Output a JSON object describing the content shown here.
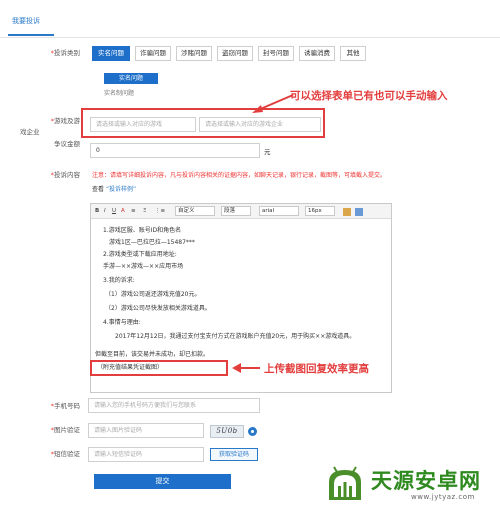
{
  "top_tab": "我要投诉",
  "labels": {
    "category": "投诉类别",
    "game_company_1": "游戏及游",
    "game_company_2": "戏企业",
    "amount": "争议金额",
    "content": "投诉内容",
    "phone": "手机号码",
    "captcha": "图片验证",
    "sms": "短信验证"
  },
  "categories": [
    "实名问题",
    "诈骗问题",
    "涉赌问题",
    "盗窃问题",
    "封号问题",
    "诱骗消费",
    "其他"
  ],
  "sub_selected": "实名问题",
  "sub_option": "实名制问题",
  "inputs": {
    "game_placeholder": "请选择或输入对应的游戏",
    "company_placeholder": "请选择或输入对应的游戏企业",
    "amount_value": "0",
    "amount_unit": "元",
    "phone_placeholder": "请输入您的手机号码方便我们与您联系",
    "captcha_placeholder": "请输入图片验证码",
    "sms_placeholder": "请输入短信验证码"
  },
  "notice": "注意：请填写详细投诉内容，凡与投诉内容相关的证据内容，如聊天记录，银行记录，截图等，可填截入提交。",
  "example": {
    "prefix": "查看",
    "link": "“投诉样例”"
  },
  "toolbar": {
    "items": [
      "B",
      "I",
      "U",
      "A",
      "≡",
      "Ξ",
      "⋮≡"
    ],
    "custom_label": "自定义",
    "paragraph_label": "段落",
    "font_label": "arial",
    "size_label": "16px"
  },
  "editor_lines": [
    "1.游戏区服、账号ID和角色名",
    "游戏1区—巴拉巴拉—15487***",
    "2.游戏类型或下载应用地址:",
    "手游—××游戏—××应用市场",
    "3.我的诉求:",
    "（1）游戏公司返还游戏充值20元。",
    "（2）游戏公司尽快发放相关游戏道具。",
    "4.事情与理由:",
    "2017年12月12日，我通过支付宝支付方式在游戏账户充值20元，用于购买××游戏道具。",
    "但截至目前，该交易并未成功，却已扣款。",
    "（附充值结果凭证截图）"
  ],
  "annotations": {
    "form_note": "可以选择表单已有也可以手动输入",
    "upload_note": "上传截图回复效率更高"
  },
  "captcha_text": "5U0b",
  "sms_button": "获取验证码",
  "submit_button": "提交",
  "watermark": {
    "name": "天源安卓网",
    "url": "www.jytyaz.com"
  },
  "colors": {
    "brand_blue": "#1d6fc9",
    "annotation_red": "#e33e3e",
    "logo_green": "#2e8a1f"
  }
}
